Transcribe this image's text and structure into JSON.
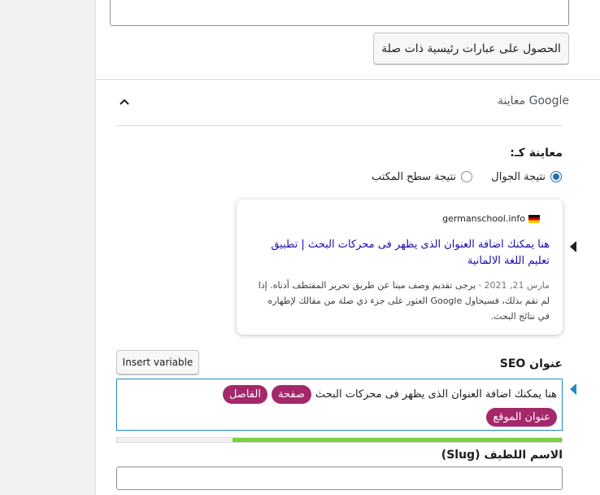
{
  "related": {
    "button_label": "الحصول على عبارات رئيسية ذات صلة"
  },
  "google_preview": {
    "section_title": "معاينة Google",
    "preview_as_label": "معاينة كـ:",
    "options": [
      {
        "label": "نتيجة الجوال",
        "checked": true
      },
      {
        "label": "نتيجة سطح المكتب",
        "checked": false
      }
    ],
    "snippet": {
      "url": "germanschool.info",
      "title": "هنا يمكنك اضافة العنوان الذى يظهر فى محركات البحث | تطبيق تعليم اللغة الالمانية",
      "date": "مارس 21, 2021",
      "description": " · يرجى تقديم وصف ميتا عن طريق تحرير المقتطف أدناه. إذا لم تقم بذلك، فسيحاول Google العثور على جزء ذي صلة من مقالك لإظهاره في نتائج البحث."
    }
  },
  "seo_title": {
    "label": "عنوان SEO",
    "insert_variable_label": "Insert variable",
    "text": "هنا يمكنك اضافة العنوان الذى يظهر فى محركات البحث",
    "pills": [
      "صفحة",
      "الفاصل",
      "عنوان الموقع"
    ],
    "progress": 0.74
  },
  "slug": {
    "label": "الاسم اللطيف (Slug)",
    "value": ""
  },
  "colors": {
    "accent": "#2271b1",
    "pill": "#a4286a",
    "progress": "#7ad03a",
    "link": "#1a0dab"
  }
}
